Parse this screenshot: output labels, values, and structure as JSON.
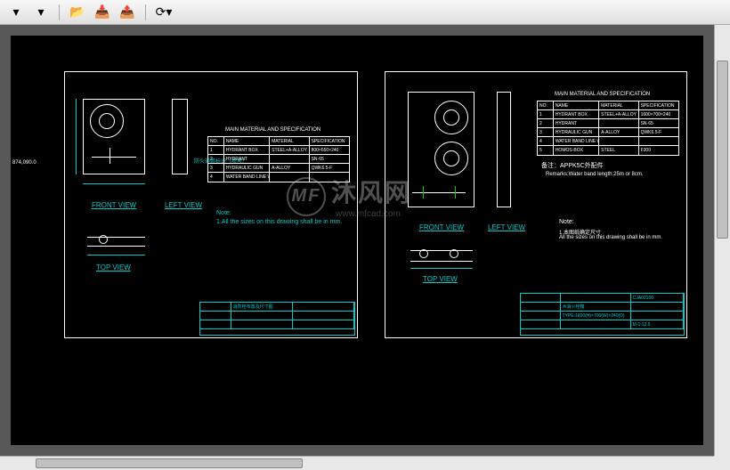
{
  "toolbar": {
    "icons": [
      "drop1",
      "drop2",
      "sep",
      "open",
      "import",
      "export",
      "sep",
      "refresh"
    ]
  },
  "side_coord": "874,090.0",
  "sheet1": {
    "front_view": "FRONT VIEW",
    "left_view": "LEFT VIEW",
    "top_view": "TOP VIEW",
    "note_label": "Note:",
    "note_text": "1.All the sizes on this drawing shall be in mm.",
    "table_title": "MAIN MATERIAL AND SPECIFICATION",
    "table": {
      "headers": {
        "no": "NO.",
        "name": "NAME",
        "material": "MATERIAL",
        "spec": "SPECIFICATION"
      },
      "rows": [
        {
          "no": "1",
          "name": "HYDRANT BOX",
          "material": "STEEL+A-ALLOY",
          "spec": "800×650×240"
        },
        {
          "no": "2",
          "name": "HYDRANT",
          "material": "",
          "spec": "SN·65"
        },
        {
          "no": "3",
          "name": "HYDRAULIC GUN",
          "material": "A-ALLOY",
          "spec": "QWK6.5-F"
        },
        {
          "no": "4",
          "name": "WATER BAND LINE WITH RUBBER",
          "material": "",
          "spec": ""
        }
      ]
    },
    "title_block": {
      "desc": "消防栓布置及尺寸图"
    },
    "anno1": "防火通道标识（参考）"
  },
  "sheet2": {
    "front_view": "FRONT VIEW",
    "left_view": "LEFT VIEW",
    "top_view": "TOP VIEW",
    "table_title": "MAIN MATERIAL AND SPECIFICATION",
    "table": {
      "headers": {
        "no": "NO.",
        "name": "NAME",
        "material": "MATERIAL",
        "spec": "SPECIFICATION"
      },
      "rows": [
        {
          "no": "1",
          "name": "HYDRANT BOX",
          "material": "STEEL+A-ALLOY",
          "spec": "1600×700×240"
        },
        {
          "no": "2",
          "name": "HYDRANT",
          "material": "",
          "spec": "SN·65"
        },
        {
          "no": "3",
          "name": "HYDRAULIC GUN",
          "material": "A-ALLOY",
          "spec": "QWK6.5-F"
        },
        {
          "no": "4",
          "name": "WATER BAND LINE WITH RUBBER",
          "material": "",
          "spec": ""
        },
        {
          "no": "5",
          "name": "HOMOS-BOX",
          "material": "STEEL",
          "spec": "F300"
        }
      ]
    },
    "remark_title": "备注：APPK5C外配件",
    "remark1": "Remarks:Water band length:25m or 8cm.",
    "note_label": "Note:",
    "note_text": "All the sizes on this drawing shall be in mm.",
    "anno2": "1.本图纸确定尺寸",
    "title_block": {
      "proj": "CJA02100",
      "desc": "水消火栓箱",
      "type": "TYPE:1600(H)×700(W)×240(D)",
      "scale": "M-1:12.5"
    }
  },
  "watermark": "沐风网",
  "watermark_url": "www.mfcad.com"
}
